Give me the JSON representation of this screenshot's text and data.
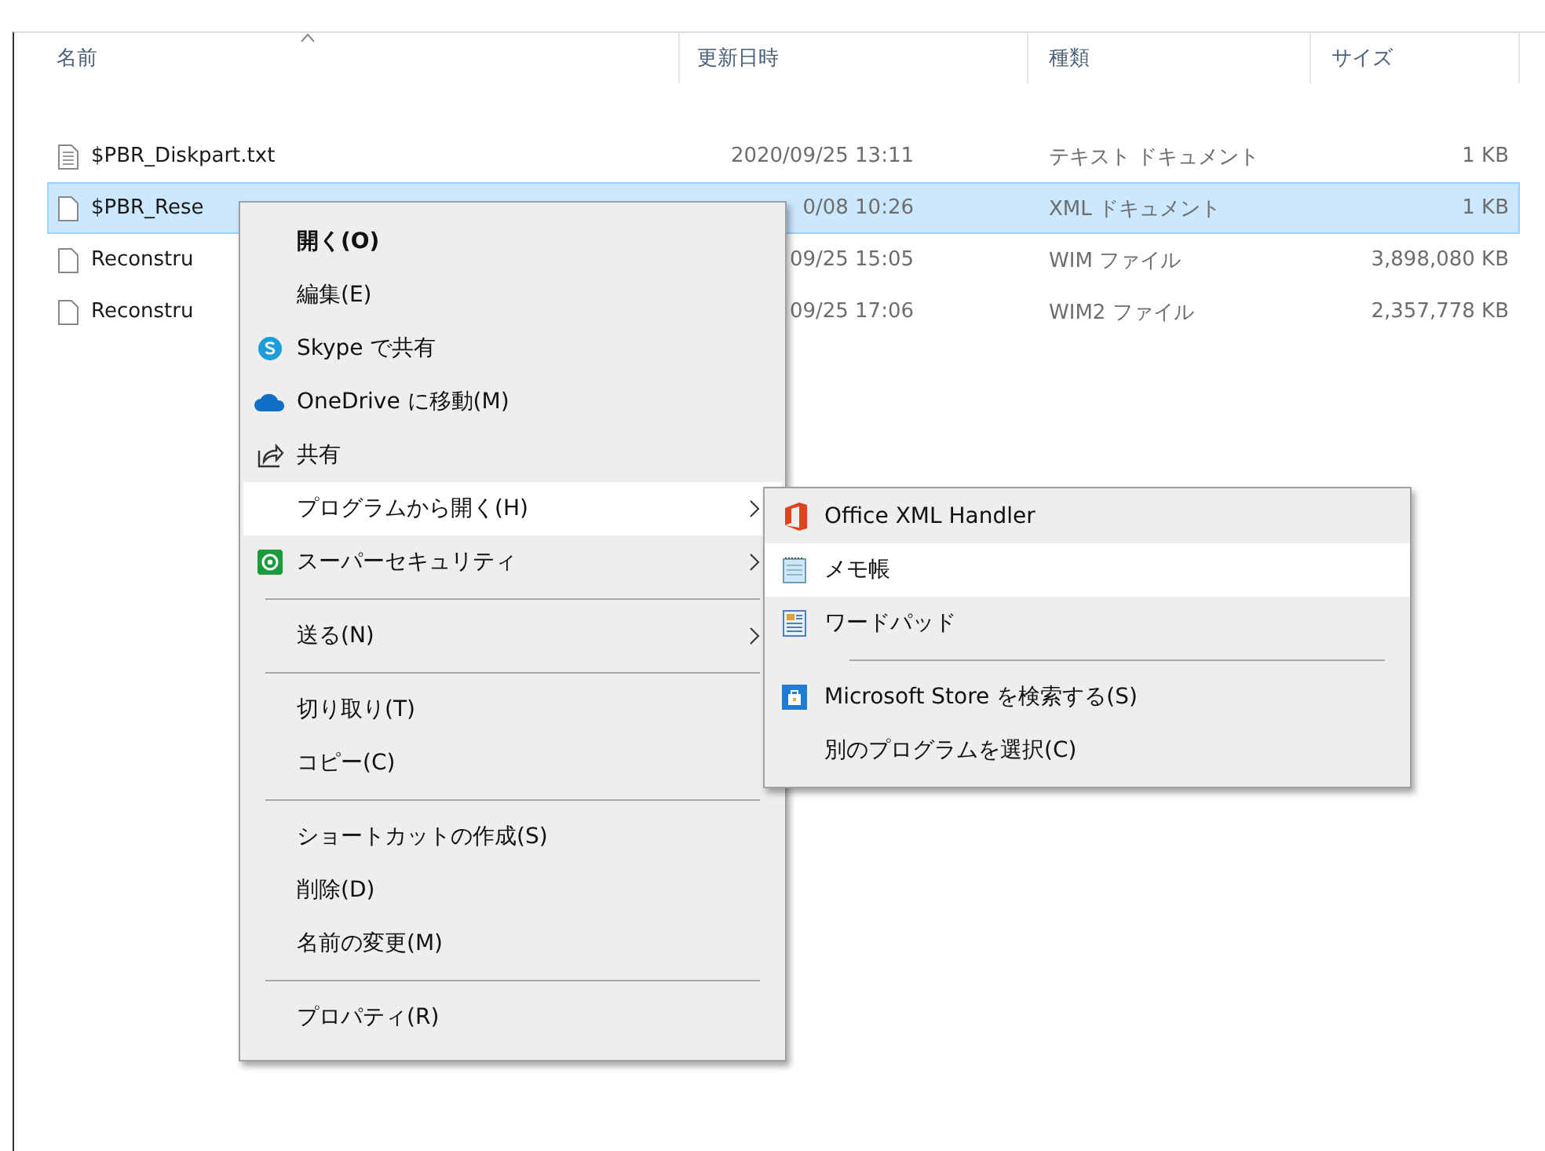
{
  "file_list": {
    "columns": [
      {
        "label": "名前",
        "sorted": true
      },
      {
        "label": "更新日時",
        "sorted": false
      },
      {
        "label": "種類",
        "sorted": false
      },
      {
        "label": "サイズ",
        "sorted": false
      }
    ],
    "rows": [
      {
        "kind": "text_file",
        "name": "$PBR_Diskpart.txt",
        "modified": "2020/09/25 13:11",
        "type": "テキスト ドキュメント",
        "size": "1 KB",
        "selected": false
      },
      {
        "kind": "file",
        "name": "$PBR_Rese",
        "modified": "0/08 10:26",
        "type": "XML ドキュメント",
        "size": "1 KB",
        "selected": true
      },
      {
        "kind": "file",
        "name": "Reconstru",
        "modified": "09/25 15:05",
        "type": "WIM ファイル",
        "size": "3,898,080 KB",
        "selected": false
      },
      {
        "kind": "file",
        "name": "Reconstru",
        "modified": "09/25 17:06",
        "type": "WIM2 ファイル",
        "size": "2,357,778 KB",
        "selected": false
      }
    ]
  },
  "context_menu": {
    "items": [
      {
        "kind": "item",
        "label": "開く(O)",
        "default": true,
        "highlighted": false,
        "submenu": false
      },
      {
        "kind": "item",
        "label": "編集(E)",
        "default": false,
        "highlighted": false,
        "submenu": false
      },
      {
        "kind": "item",
        "label": "Skype で共有",
        "default": false,
        "highlighted": false,
        "submenu": false
      },
      {
        "kind": "item",
        "label": "OneDrive に移動(M)",
        "default": false,
        "highlighted": false,
        "submenu": false
      },
      {
        "kind": "item",
        "label": "共有",
        "default": false,
        "highlighted": false,
        "submenu": false
      },
      {
        "kind": "item",
        "label": "プログラムから開く(H)",
        "default": false,
        "highlighted": true,
        "submenu": true
      },
      {
        "kind": "item",
        "label": "スーパーセキュリティ",
        "default": false,
        "highlighted": false,
        "submenu": true
      },
      {
        "kind": "separator"
      },
      {
        "kind": "item",
        "label": "送る(N)",
        "default": false,
        "highlighted": false,
        "submenu": true
      },
      {
        "kind": "separator"
      },
      {
        "kind": "item",
        "label": "切り取り(T)",
        "default": false,
        "highlighted": false,
        "submenu": false
      },
      {
        "kind": "item",
        "label": "コピー(C)",
        "default": false,
        "highlighted": false,
        "submenu": false
      },
      {
        "kind": "separator"
      },
      {
        "kind": "item",
        "label": "ショートカットの作成(S)",
        "default": false,
        "highlighted": false,
        "submenu": false
      },
      {
        "kind": "item",
        "label": "削除(D)",
        "default": false,
        "highlighted": false,
        "submenu": false
      },
      {
        "kind": "item",
        "label": "名前の変更(M)",
        "default": false,
        "highlighted": false,
        "submenu": false
      },
      {
        "kind": "separator"
      },
      {
        "kind": "item",
        "label": "プロパティ(R)",
        "default": false,
        "highlighted": false,
        "submenu": false
      }
    ]
  },
  "open_with_submenu": {
    "items": [
      {
        "kind": "item",
        "label": "Office XML Handler",
        "highlighted": false
      },
      {
        "kind": "item",
        "label": "メモ帳",
        "highlighted": true
      },
      {
        "kind": "item",
        "label": "ワードパッド",
        "highlighted": false
      },
      {
        "kind": "separator"
      },
      {
        "kind": "item",
        "label": "Microsoft Store を検索する(S)",
        "highlighted": false
      },
      {
        "kind": "item",
        "label": "別のプログラムを選択(C)",
        "highlighted": false
      }
    ]
  }
}
